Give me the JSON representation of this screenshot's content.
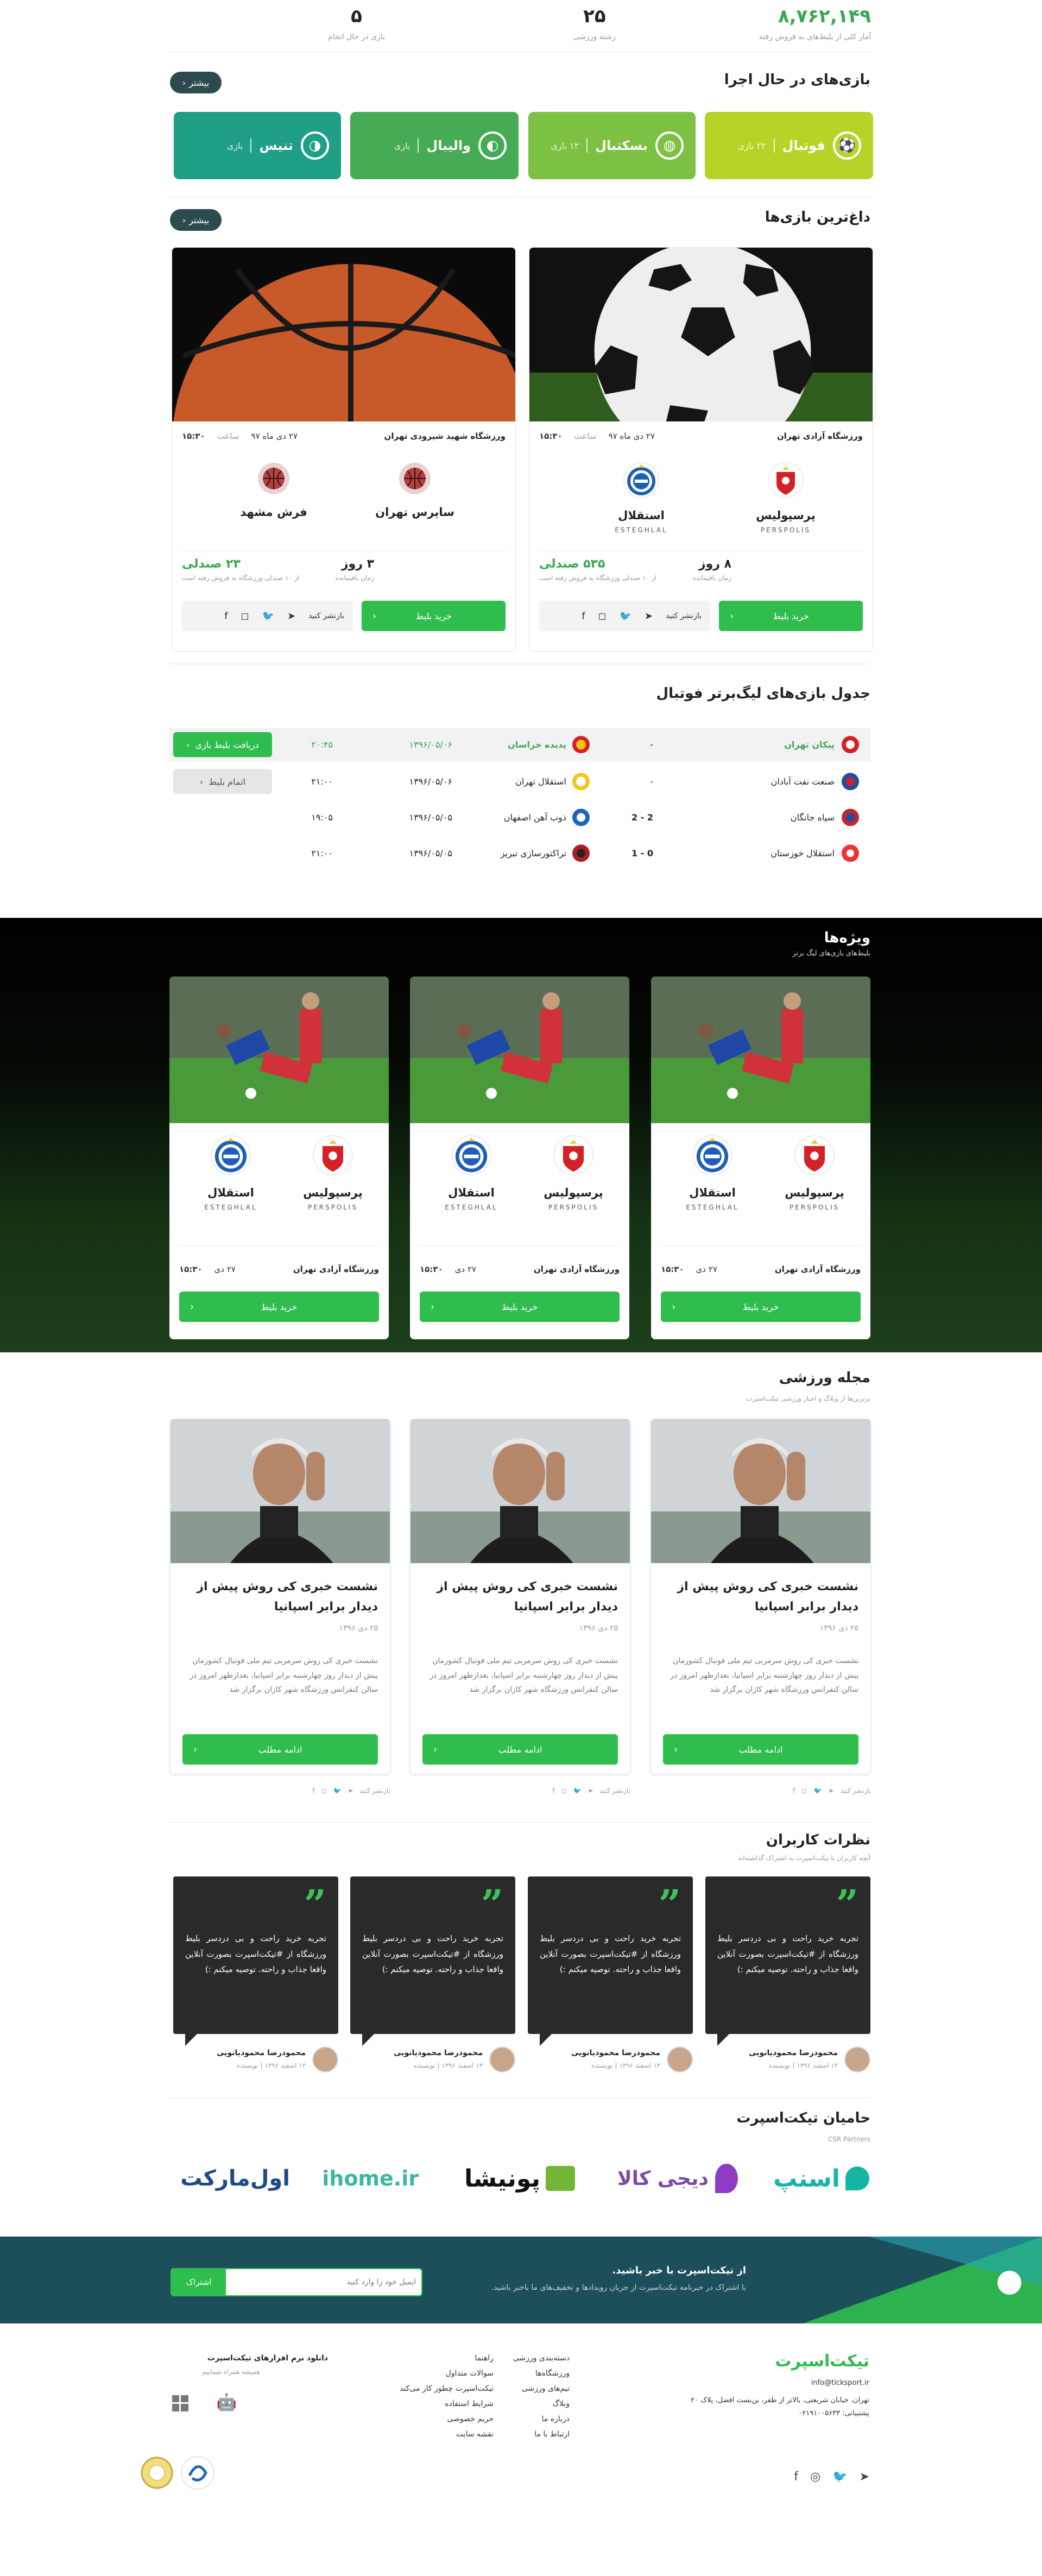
{
  "stats": [
    {
      "value": "۸,۷۶۲,۱۴۹",
      "label": "آمار کلی از بلیط‌های به فروش رفته"
    },
    {
      "value": "۲۵",
      "label": "رشته ورزشی"
    },
    {
      "value": "۵",
      "label": "بازی در حال انجام"
    }
  ],
  "live": {
    "title": "بازی‌های در حال اجرا",
    "more": "بیشتر",
    "tiles": [
      {
        "name": "فوتبال",
        "count": "۲۲ بازی",
        "color": "#b6d428"
      },
      {
        "name": "بسکتبال",
        "count": "۱۲ بازی",
        "color": "#7cc143"
      },
      {
        "name": "والیبال",
        "count": "بازی",
        "color": "#47ab55"
      },
      {
        "name": "تنیس",
        "count": "بازی",
        "color": "#1e9f86"
      }
    ]
  },
  "hot": {
    "title": "داغ‌ترین بازی‌ها",
    "more": "بیشتر",
    "cards": [
      {
        "venue": "ورزشگاه آزادی تهران",
        "date": "۲۷ دی ماه ۹۷",
        "time_label": "ساعت",
        "time": "۱۵:۳۰",
        "home": {
          "name": "پرسپولیس",
          "en": "PERSPOLIS"
        },
        "away": {
          "name": "استقلال",
          "en": "ESTEGHLAL"
        },
        "seats": "۵۳۵ صندلی",
        "seats_note": "از ۱۰ صندلی ورزشگاه به فروش رفته است",
        "days": "۸ روز",
        "days_note": "زمان باقیمانده",
        "buy": "خرید بلیط",
        "share": "بازنشر کنید"
      },
      {
        "venue": "ورزشگاه شهید شیرودی تهران",
        "date": "۲۷ دی ماه ۹۷",
        "time_label": "ساعت",
        "time": "۱۵:۳۰",
        "home": {
          "name": "سایرس تهران",
          "en": ""
        },
        "away": {
          "name": "فرش مشهد",
          "en": ""
        },
        "seats": "۲۳ صندلی",
        "seats_note": "از ۱۰ صندلی ورزشگاه به فروش رفته است",
        "days": "۳ روز",
        "days_note": "زمان باقیمانده",
        "buy": "خرید بلیط",
        "share": "بازنشر کنید"
      }
    ]
  },
  "league": {
    "title": "جدول بازی‌های لیگ‌برتر فوتبال",
    "rows": [
      {
        "home": "پیکان تهران",
        "score": "-",
        "away": "پدیده خراسان",
        "date": "۱۳۹۶/۰۵/۰۶",
        "time": "۲۰:۴۵",
        "action": "دریافت بلیط بازی",
        "active": true
      },
      {
        "home": "صنعت نفت آبادان",
        "score": "-",
        "away": "استقلال تهران",
        "date": "۱۳۹۶/۰۵/۰۶",
        "time": "۲۱:۰۰",
        "action": "اتمام بلیط",
        "active": false
      },
      {
        "home": "سپاه جانگان",
        "score": "2 - 2",
        "away": "ذوب آهن اصفهان",
        "date": "۱۳۹۶/۰۵/۰۵",
        "time": "۱۹:۰۵",
        "action": "",
        "active": false
      },
      {
        "home": "استقلال خوزستان",
        "score": "0 - 1",
        "away": "تراکتورسازی تبریز",
        "date": "۱۳۹۶/۰۵/۰۵",
        "time": "۲۱:۰۰",
        "action": "",
        "active": false
      }
    ]
  },
  "specials": {
    "title": "ویژه‌ها",
    "subtitle": "بلیط‌های بازی‌های لیگ برتر",
    "cards": [
      {
        "home": "پرسپولیس",
        "home_en": "PERSPOLIS",
        "away": "استقلال",
        "away_en": "ESTEGHLAL",
        "venue": "ورزشگاه آزادی تهران",
        "date": "۲۷ دی",
        "time": "۱۵:۳۰",
        "buy": "خرید بلیط"
      },
      {
        "home": "پرسپولیس",
        "home_en": "PERSPOLIS",
        "away": "استقلال",
        "away_en": "ESTEGHLAL",
        "venue": "ورزشگاه آزادی تهران",
        "date": "۲۷ دی",
        "time": "۱۵:۳۰",
        "buy": "خرید بلیط"
      },
      {
        "home": "پرسپولیس",
        "home_en": "PERSPOLIS",
        "away": "استقلال",
        "away_en": "ESTEGHLAL",
        "venue": "ورزشگاه آزادی تهران",
        "date": "۲۷ دی",
        "time": "۱۵:۳۰",
        "buy": "خرید بلیط"
      }
    ]
  },
  "magazine": {
    "title": "مجله ورزشی",
    "subtitle": "برترین‌ها از وبلاگ و اخبار ورزشی تیکت‌اسپرت",
    "posts": [
      {
        "title": "نشست خبری کی روش پیش از دیدار برابر اسپانیا",
        "date": "۲۵ دی ۱۳۹۶",
        "body": "نشست خبری کی روش سرمربی تیم ملی فوتبال کشورمان پیش از دیدار روز چهارشنبه برابر اسپانیا، بعدازظهر امروز در سالن کنفرانس ورزشگاه شهر کازان برگزار شد",
        "more": "ادامه مطلب",
        "share": "بازنشر کنید"
      },
      {
        "title": "نشست خبری کی روش پیش از دیدار برابر اسپانیا",
        "date": "۲۵ دی ۱۳۹۶",
        "body": "نشست خبری کی روش سرمربی تیم ملی فوتبال کشورمان پیش از دیدار روز چهارشنبه برابر اسپانیا، بعدازظهر امروز در سالن کنفرانس ورزشگاه شهر کازان برگزار شد",
        "more": "ادامه مطلب",
        "share": "بازنشر کنید"
      },
      {
        "title": "نشست خبری کی روش پیش از دیدار برابر اسپانیا",
        "date": "۲۵ دی ۱۳۹۶",
        "body": "نشست خبری کی روش سرمربی تیم ملی فوتبال کشورمان پیش از دیدار روز چهارشنبه برابر اسپانیا، بعدازظهر امروز در سالن کنفرانس ورزشگاه شهر کازان برگزار شد",
        "more": "ادامه مطلب",
        "share": "بازنشر کنید"
      }
    ]
  },
  "comments": {
    "title": "نظرات کاربران",
    "subtitle": "آنچه کاربران با تیکت‌اسپرت به اشتراک گذاشته‌اند",
    "items": [
      {
        "text": "تجربه خرید راحت و بی دردسر بلیط ورزشگاه از #تیکت‌اسپرت بصورت آنلاین واقعا جذاب و راحته. توصیه میکنم :)",
        "user": "محمودرضا محمودیانویی",
        "date": "۱۳ اسفند ۱۳۹۶ | نویسنده"
      },
      {
        "text": "تجربه خرید راحت و بی دردسر بلیط ورزشگاه از #تیکت‌اسپرت بصورت آنلاین واقعا جذاب و راحته. توصیه میکنم :)",
        "user": "محمودرضا محمودیانویی",
        "date": "۱۳ اسفند ۱۳۹۶ | نویسنده"
      },
      {
        "text": "تجربه خرید راحت و بی دردسر بلیط ورزشگاه از #تیکت‌اسپرت بصورت آنلاین واقعا جذاب و راحته. توصیه میکنم :)",
        "user": "محمودرضا محمودیانویی",
        "date": "۱۳ اسفند ۱۳۹۶ | نویسنده"
      },
      {
        "text": "تجربه خرید راحت و بی دردسر بلیط ورزشگاه از #تیکت‌اسپرت بصورت آنلاین واقعا جذاب و راحته. توصیه میکنم :)",
        "user": "محمودرضا محمودیانویی",
        "date": "۱۳ اسفند ۱۳۹۶ | نویسنده"
      }
    ]
  },
  "sponsors": {
    "title": "حامیان تیکت‌اسپرت",
    "subtitle": "CSR Partners",
    "names": [
      "اسنپ",
      "دیجی کالا",
      "پونیشا",
      "ihome.ir",
      "اول‌مارکت"
    ]
  },
  "newsletter": {
    "title": "از تیکت‌اسپرت با خبر باشید.",
    "text": "با اشتراک در خبرنامه تیکت‌اسپرت از جریان رویدادها و تخفیف‌های ما باخبر باشید.",
    "placeholder": "ایمیل خود را وارد کنید",
    "button": "اشتراک"
  },
  "footer": {
    "logo": "تیکت‌اسپرت",
    "email": "info@ticksport.ir",
    "address": "تهران، خیابان شریعتی، بالاتر از ظفر، بن‌بست افضل، پلاک ۲۰",
    "support": "پشتیبانی: ۰۲۱۹۱۰۰۵۶۳۳",
    "col1": [
      "دسته‌بندی ورزشی",
      "ورزشگاه‌ها",
      "تیم‌های ورزشی",
      "وبلاگ",
      "درباره ما",
      "ارتباط با ما"
    ],
    "col2": [
      "راهنما",
      "سوالات متداول",
      "تیکت‌اسپرت چطور کار می‌کند",
      "شرایط استفاده",
      "حریم خصوصی",
      "نقشه سایت"
    ],
    "apps_title": "دانلود نرم افزارهای تیکت‌اسپرت",
    "apps_sub": "همیشه همراه شماییم"
  },
  "colors": {
    "accent": "#2fbd4e",
    "dark": "#2d4b4f",
    "news_bg": "#1d4f5a"
  }
}
